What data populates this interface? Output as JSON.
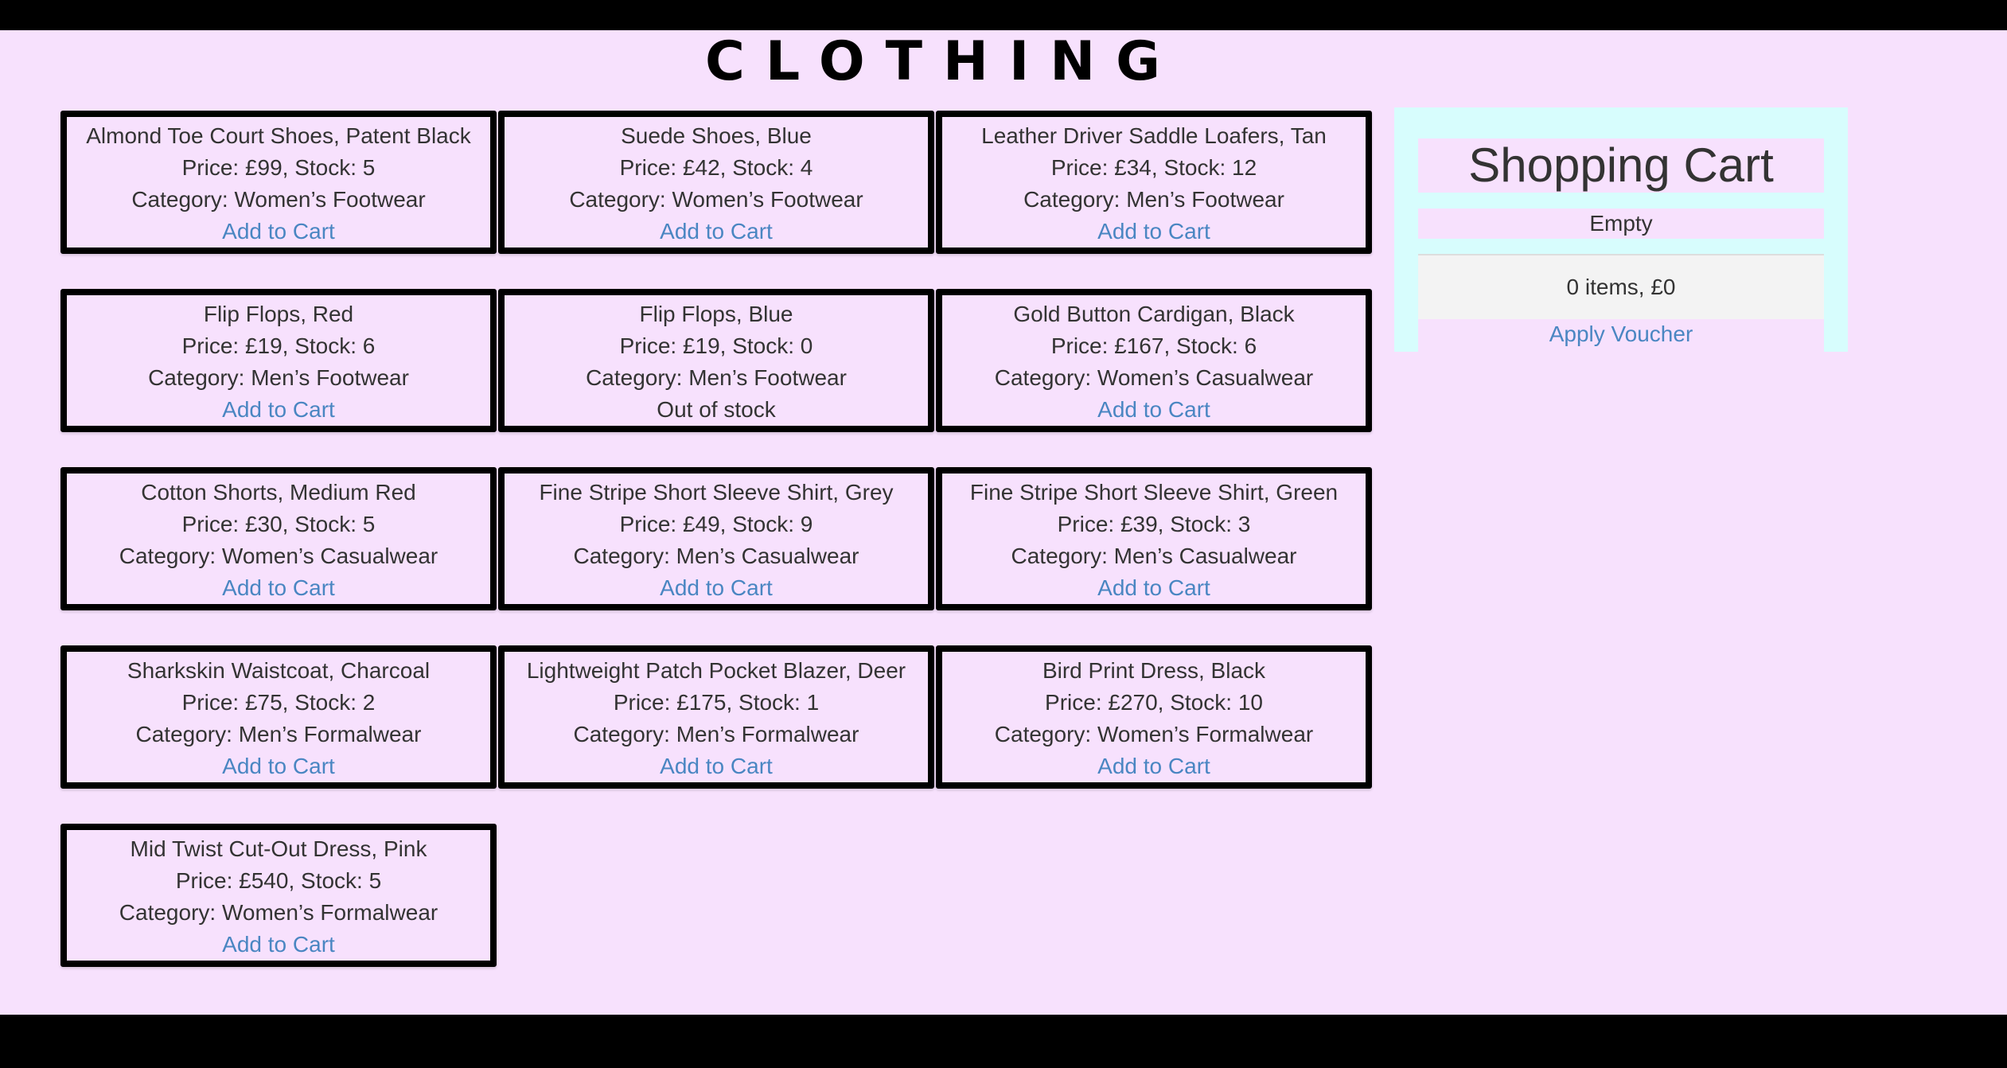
{
  "header": {
    "title": "CLOTHING"
  },
  "products": [
    {
      "name": "Almond Toe Court Shoes, Patent Black",
      "price_stock": "Price: £99, Stock: 5",
      "category": "Category: Women’s Footwear",
      "action": "Add to Cart"
    },
    {
      "name": "Suede Shoes, Blue",
      "price_stock": "Price: £42, Stock: 4",
      "category": "Category: Women’s Footwear",
      "action": "Add to Cart"
    },
    {
      "name": "Leather Driver Saddle Loafers, Tan",
      "price_stock": "Price: £34, Stock: 12",
      "category": "Category: Men’s Footwear",
      "action": "Add to Cart"
    },
    {
      "name": "Flip Flops, Red",
      "price_stock": "Price: £19, Stock: 6",
      "category": "Category: Men’s Footwear",
      "action": "Add to Cart"
    },
    {
      "name": "Flip Flops, Blue",
      "price_stock": "Price: £19, Stock: 0",
      "category": "Category: Men’s Footwear",
      "action": "Out of stock"
    },
    {
      "name": "Gold Button Cardigan, Black",
      "price_stock": "Price: £167, Stock: 6",
      "category": "Category: Women’s Casualwear",
      "action": "Add to Cart"
    },
    {
      "name": "Cotton Shorts, Medium Red",
      "price_stock": "Price: £30, Stock: 5",
      "category": "Category: Women’s Casualwear",
      "action": "Add to Cart"
    },
    {
      "name": "Fine Stripe Short Sleeve Shirt, Grey",
      "price_stock": "Price: £49, Stock: 9",
      "category": "Category: Men’s Casualwear",
      "action": "Add to Cart"
    },
    {
      "name": "Fine Stripe Short Sleeve Shirt, Green",
      "price_stock": "Price: £39, Stock: 3",
      "category": "Category: Men’s Casualwear",
      "action": "Add to Cart"
    },
    {
      "name": "Sharkskin Waistcoat, Charcoal",
      "price_stock": "Price: £75, Stock: 2",
      "category": "Category: Men’s Formalwear",
      "action": "Add to Cart"
    },
    {
      "name": "Lightweight Patch Pocket Blazer, Deer",
      "price_stock": "Price: £175, Stock: 1",
      "category": "Category: Men’s Formalwear",
      "action": "Add to Cart"
    },
    {
      "name": "Bird Print Dress, Black",
      "price_stock": "Price: £270, Stock: 10",
      "category": "Category: Women’s Formalwear",
      "action": "Add to Cart"
    },
    {
      "name": "Mid Twist Cut-Out Dress, Pink",
      "price_stock": "Price: £540, Stock: 5",
      "category": "Category: Women’s Formalwear",
      "action": "Add to Cart"
    }
  ],
  "cart": {
    "heading": "Shopping Cart",
    "status": "Empty",
    "summary": "0 items, £0",
    "voucher_label": "Apply Voucher"
  },
  "colors": {
    "page_background": "#f7e1fd",
    "cart_background": "#d7fdfd",
    "link": "#4a86c2",
    "border": "#000000"
  }
}
